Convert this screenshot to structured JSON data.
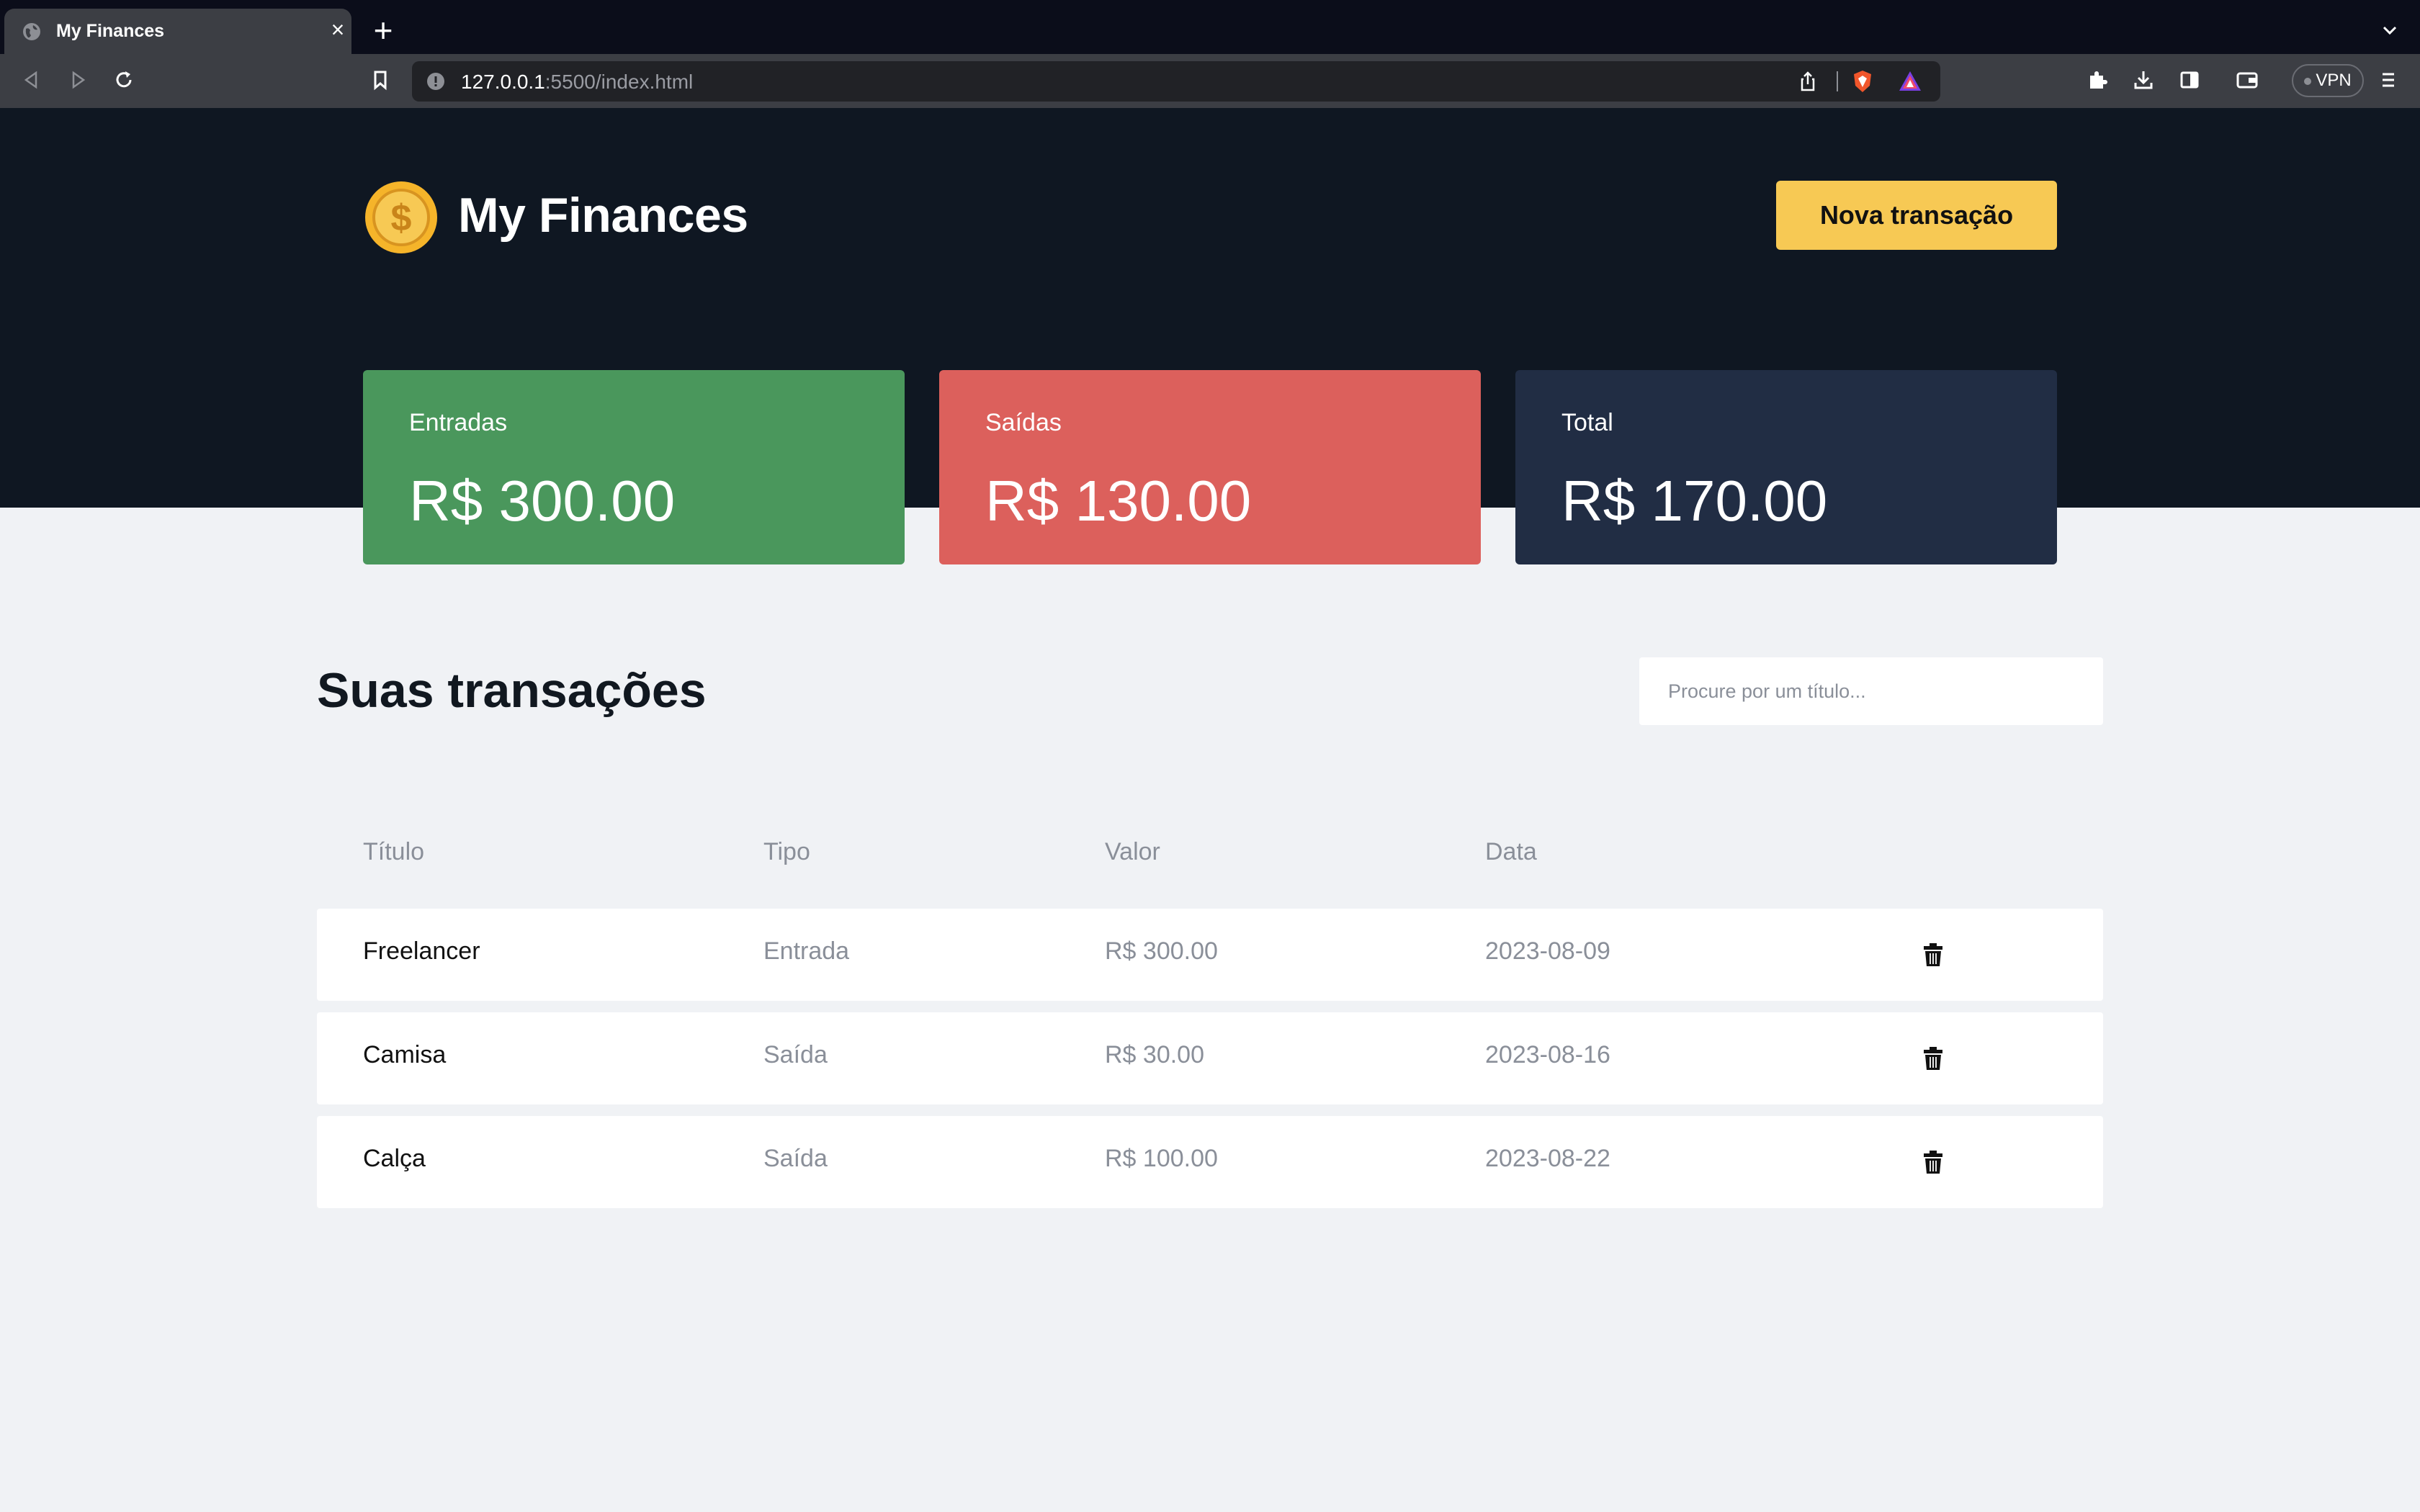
{
  "browser": {
    "tab_title": "My Finances",
    "tab_close": "×",
    "new_tab": "+",
    "url_host": "127.0.0.1",
    "url_rest": ":5500/index.html",
    "vpn_label": "VPN"
  },
  "header": {
    "app_title": "My Finances",
    "new_transaction_label": "Nova transação"
  },
  "summary": {
    "income_label": "Entradas",
    "income_value": "R$ 300.00",
    "outcome_label": "Saídas",
    "outcome_value": "R$ 130.00",
    "total_label": "Total",
    "total_value": "R$ 170.00"
  },
  "transactions": {
    "heading": "Suas transações",
    "search_placeholder": "Procure por um título...",
    "columns": [
      "Título",
      "Tipo",
      "Valor",
      "Data"
    ],
    "rows": [
      {
        "title": "Freelancer",
        "type": "Entrada",
        "value": "R$ 300.00",
        "date": "2023-08-09"
      },
      {
        "title": "Camisa",
        "type": "Saída",
        "value": "R$ 30.00",
        "date": "2023-08-16"
      },
      {
        "title": "Calça",
        "type": "Saída",
        "value": "R$ 100.00",
        "date": "2023-08-22"
      }
    ]
  },
  "colors": {
    "hero_bg": "#0f1722",
    "income": "#4a975c",
    "outcome": "#dc605c",
    "total": "#212d44",
    "accent": "#f7c954",
    "page_bg": "#f0f2f5"
  },
  "icons": [
    "globe-icon",
    "close-icon",
    "plus-icon",
    "chevron-down-icon",
    "back-icon",
    "forward-icon",
    "reload-icon",
    "bookmark-icon",
    "info-icon",
    "share-icon",
    "brave-shield-icon",
    "brave-rewards-icon",
    "extensions-icon",
    "download-icon",
    "sidebar-icon",
    "wallet-icon",
    "menu-icon",
    "coin-logo-icon",
    "trash-icon"
  ]
}
